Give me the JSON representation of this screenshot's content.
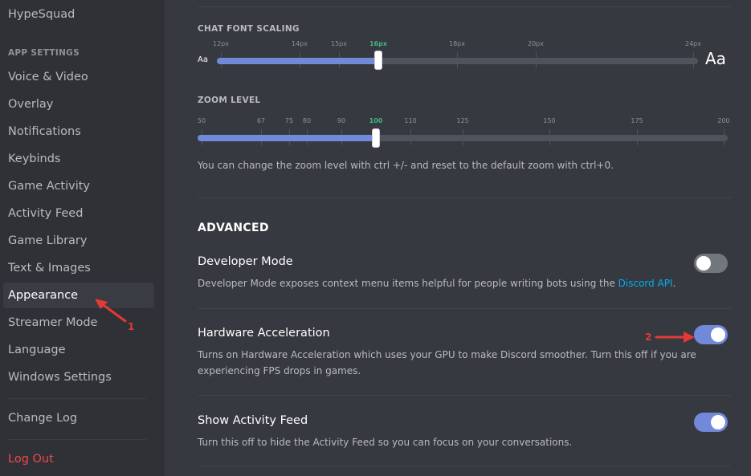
{
  "sidebar": {
    "top_item": "HypeSquad",
    "section_header": "APP SETTINGS",
    "items": [
      {
        "label": "Voice & Video"
      },
      {
        "label": "Overlay"
      },
      {
        "label": "Notifications"
      },
      {
        "label": "Keybinds"
      },
      {
        "label": "Game Activity"
      },
      {
        "label": "Activity Feed"
      },
      {
        "label": "Game Library"
      },
      {
        "label": "Text & Images"
      },
      {
        "label": "Appearance",
        "selected": true
      },
      {
        "label": "Streamer Mode"
      },
      {
        "label": "Language"
      },
      {
        "label": "Windows Settings"
      }
    ],
    "change_log": "Change Log",
    "log_out": "Log Out"
  },
  "chat_font_scaling": {
    "label": "CHAT FONT SCALING",
    "markers": [
      "12px",
      "14px",
      "15px",
      "16px",
      "18px",
      "20px",
      "24px"
    ],
    "selected": "16px",
    "small_preview": "Aa",
    "large_preview": "Aa"
  },
  "zoom_level": {
    "label": "ZOOM LEVEL",
    "markers": [
      "50",
      "67",
      "75",
      "80",
      "90",
      "100",
      "110",
      "125",
      "150",
      "175",
      "200"
    ],
    "selected": "100",
    "hint": "You can change the zoom level with ctrl +/- and reset to the default zoom with ctrl+0."
  },
  "advanced": {
    "title": "ADVANCED",
    "developer_mode": {
      "title": "Developer Mode",
      "desc_prefix": "Developer Mode exposes context menu items helpful for people writing bots using the ",
      "link": "Discord API",
      "desc_suffix": ".",
      "enabled": false
    },
    "hardware_acceleration": {
      "title": "Hardware Acceleration",
      "desc": "Turns on Hardware Acceleration which uses your GPU to make Discord smoother. Turn this off if you are experiencing FPS drops in games.",
      "enabled": true
    },
    "show_activity_feed": {
      "title": "Show Activity Feed",
      "desc": "Turn this off to hide the Activity Feed so you can focus on your conversations.",
      "enabled": true
    }
  },
  "annotations": {
    "arrow_1": "1",
    "arrow_2": "2",
    "color": "#e53935"
  }
}
